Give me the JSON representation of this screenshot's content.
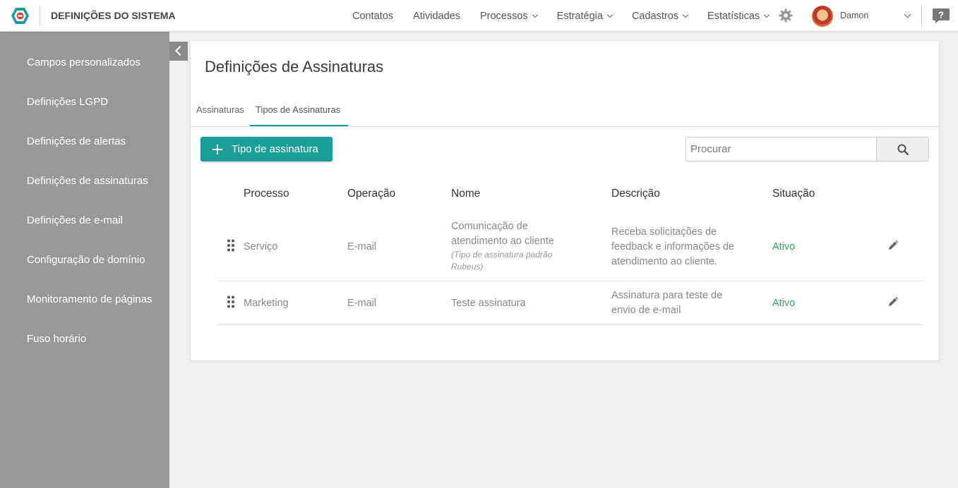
{
  "header": {
    "title": "DEFINIÇÕES DO SISTEMA",
    "nav": [
      {
        "label": "Contatos",
        "has_dropdown": false
      },
      {
        "label": "Atividades",
        "has_dropdown": false
      },
      {
        "label": "Processos",
        "has_dropdown": true
      },
      {
        "label": "Estratégia",
        "has_dropdown": true
      },
      {
        "label": "Cadastros",
        "has_dropdown": true
      },
      {
        "label": "Estatísticas",
        "has_dropdown": true
      }
    ],
    "user_name": "Damon",
    "icons": {
      "logo": "logo-icon",
      "settings": "gear-icon",
      "help": "help-chat-icon"
    }
  },
  "sidebar": {
    "items": [
      {
        "label": "Campos personalizados"
      },
      {
        "label": "Definições LGPD"
      },
      {
        "label": "Definições de alertas"
      },
      {
        "label": "Definições de assinaturas"
      },
      {
        "label": "Definições de e-mail"
      },
      {
        "label": "Configuração de domínio"
      },
      {
        "label": "Monitoramento de páginas"
      },
      {
        "label": "Fuso horário"
      }
    ]
  },
  "main": {
    "title": "Definições de Assinaturas",
    "tabs": [
      {
        "label": "Assinaturas",
        "active": false
      },
      {
        "label": "Tipos de Assinaturas",
        "active": true
      }
    ],
    "add_button_label": "Tipo de assinatura",
    "search_placeholder": "Procurar",
    "table": {
      "columns": [
        "Processo",
        "Operação",
        "Nome",
        "Descrição",
        "Situação"
      ],
      "rows": [
        {
          "processo": "Serviço",
          "operacao": "E-mail",
          "nome": "Comunicação de atendimento ao cliente",
          "nome_sub": "(Tipo de assinatura padrão Rubeus)",
          "descricao": "Receba solicitações de feedback e informações de atendimento ao cliente.",
          "situacao": "Ativo"
        },
        {
          "processo": "Marketing",
          "operacao": "E-mail",
          "nome": "Teste assinatura",
          "nome_sub": "",
          "descricao": "Assinatura para teste de envio de e-mail",
          "situacao": "Ativo"
        }
      ]
    }
  },
  "colors": {
    "accent": "#1a9e99",
    "sidebar_bg": "#999999",
    "status_active": "#2ca84a",
    "page_bg": "#f0f0f0"
  }
}
